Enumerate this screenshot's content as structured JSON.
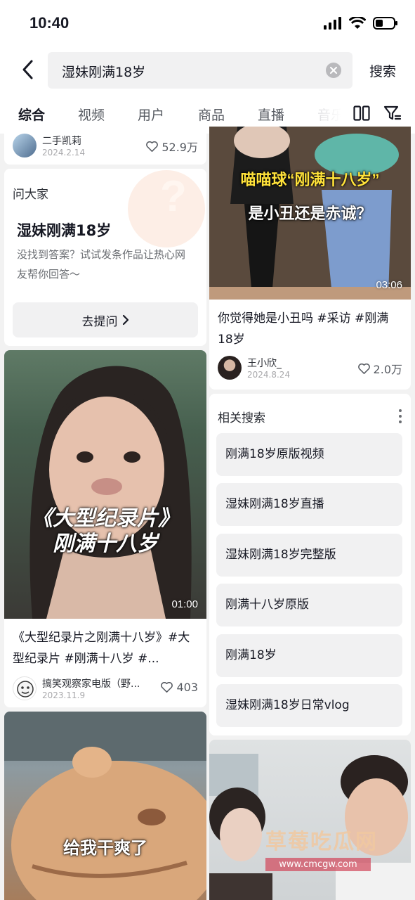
{
  "status_bar": {
    "time": "10:40"
  },
  "search": {
    "query": "湿妹刚满18岁",
    "submit_label": "搜索"
  },
  "tabs": [
    {
      "label": "综合",
      "active": true
    },
    {
      "label": "视频"
    },
    {
      "label": "用户"
    },
    {
      "label": "商品"
    },
    {
      "label": "直播"
    },
    {
      "label": "音乐"
    }
  ],
  "cards": {
    "top_left": {
      "author": "二手凯莉",
      "date": "2024.2.14",
      "likes": "52.9万"
    },
    "ask": {
      "label": "问大家",
      "title": "湿妹刚满18岁",
      "description": "没找到答案？试试发条作品让热心网友帮你回答～",
      "button": "去提问"
    },
    "video_right_top": {
      "overlay_line1": "喵喵球“刚满十八岁”",
      "overlay_line2": "是小丑还是赤诚？",
      "duration": "03:06",
      "title": "你觉得她是小丑吗 #采访 #刚满18岁",
      "author": "王小欣_",
      "date": "2024.8.24",
      "likes": "2.0万"
    },
    "video_left_mid": {
      "overlay_line1": "《大型纪录片》",
      "overlay_line2": "刚满十八岁",
      "duration": "01:00",
      "title": "《大型纪录片之刚满十八岁》#大型纪录片 #刚满十八岁 #...",
      "author": "搞笑观察家电版（野...",
      "date": "2023.11.9",
      "likes": "403"
    },
    "video_left_bottom": {
      "overlay": "给我干爽了"
    }
  },
  "related": {
    "header": "相关搜索",
    "items": [
      "刚满18岁原版视频",
      "湿妹刚满18岁直播",
      "湿妹刚满18岁完整版",
      "刚满十八岁原版",
      "刚满18岁",
      "湿妹刚满18岁日常vlog"
    ]
  },
  "watermark": {
    "title": "草莓吃瓜网",
    "url": "www.cmcgw.com"
  },
  "colors": {
    "text": "#161823",
    "secondary": "#565a61",
    "chip": "#f1f1f2",
    "background": "#f2f2f2"
  }
}
